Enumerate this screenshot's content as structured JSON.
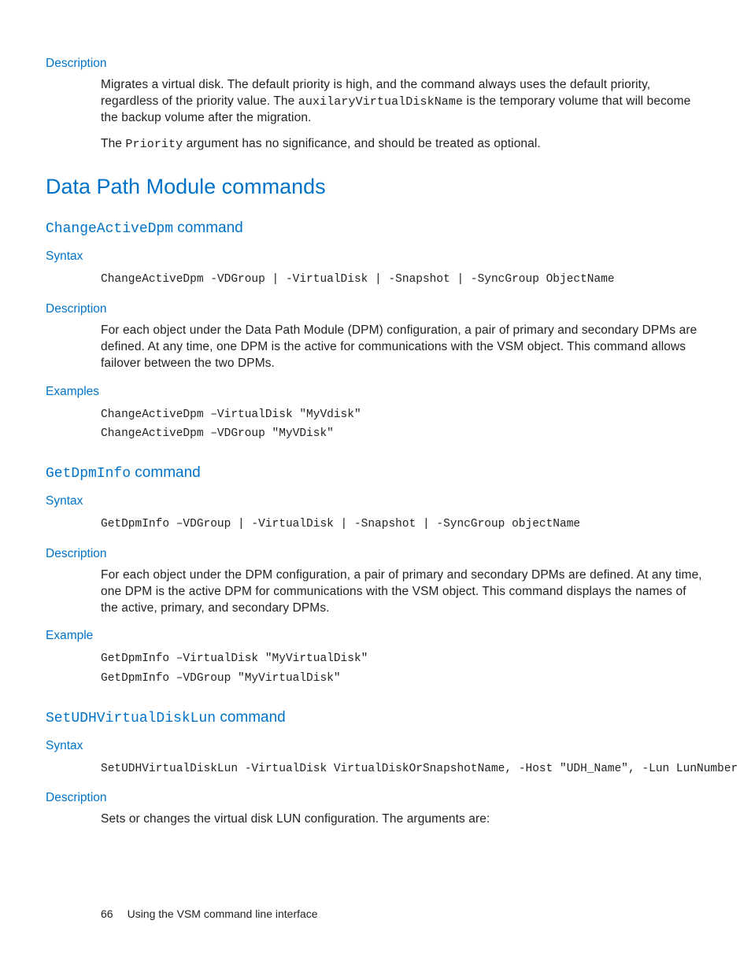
{
  "top": {
    "desc_label": "Description",
    "desc_p1_a": "Migrates a virtual disk. The default priority is high, and the command always uses the default priority, regardless of the priority value. The ",
    "desc_p1_code": "auxilaryVirtualDiskName",
    "desc_p1_b": " is the temporary volume that will become the backup volume after the migration.",
    "desc_p2_a": "The ",
    "desc_p2_code": "Priority",
    "desc_p2_b": " argument has no significance, and should be treated as optional."
  },
  "section_title": "Data Path Module commands",
  "cmd1": {
    "name": "ChangeActiveDpm",
    "suffix": " command",
    "syntax_label": "Syntax",
    "syntax": "ChangeActiveDpm -VDGroup | -VirtualDisk | -Snapshot | -SyncGroup ObjectName",
    "desc_label": "Description",
    "desc": "For each object under the Data Path Module (DPM) configuration, a pair of primary and secondary DPMs are defined. At any time, one DPM is the active for communications with the VSM object. This command allows failover between the two DPMs.",
    "ex_label": "Examples",
    "ex": "ChangeActiveDpm –VirtualDisk \"MyVdisk\"\nChangeActiveDpm –VDGroup \"MyVDisk\""
  },
  "cmd2": {
    "name": "GetDpmInfo",
    "suffix": " command",
    "syntax_label": "Syntax",
    "syntax": "GetDpmInfo –VDGroup | -VirtualDisk | -Snapshot | -SyncGroup objectName",
    "desc_label": "Description",
    "desc": "For each object under the DPM configuration, a pair of primary and secondary DPMs are defined. At any time, one DPM is the active DPM for communications with the VSM object. This command displays the names of the active, primary, and secondary DPMs.",
    "ex_label": "Example",
    "ex": "GetDpmInfo –VirtualDisk \"MyVirtualDisk\"\nGetDpmInfo –VDGroup \"MyVirtualDisk\""
  },
  "cmd3": {
    "name": "SetUDHVirtualDiskLun",
    "suffix": " command",
    "syntax_label": "Syntax",
    "syntax": "SetUDHVirtualDiskLun -VirtualDisk VirtualDiskOrSnapshotName, -Host \"UDH_Name\", -Lun LunNumber",
    "desc_label": "Description",
    "desc": "Sets or changes the virtual disk LUN configuration. The arguments are:"
  },
  "footer": {
    "page": "66",
    "title": "Using the VSM command line interface"
  }
}
